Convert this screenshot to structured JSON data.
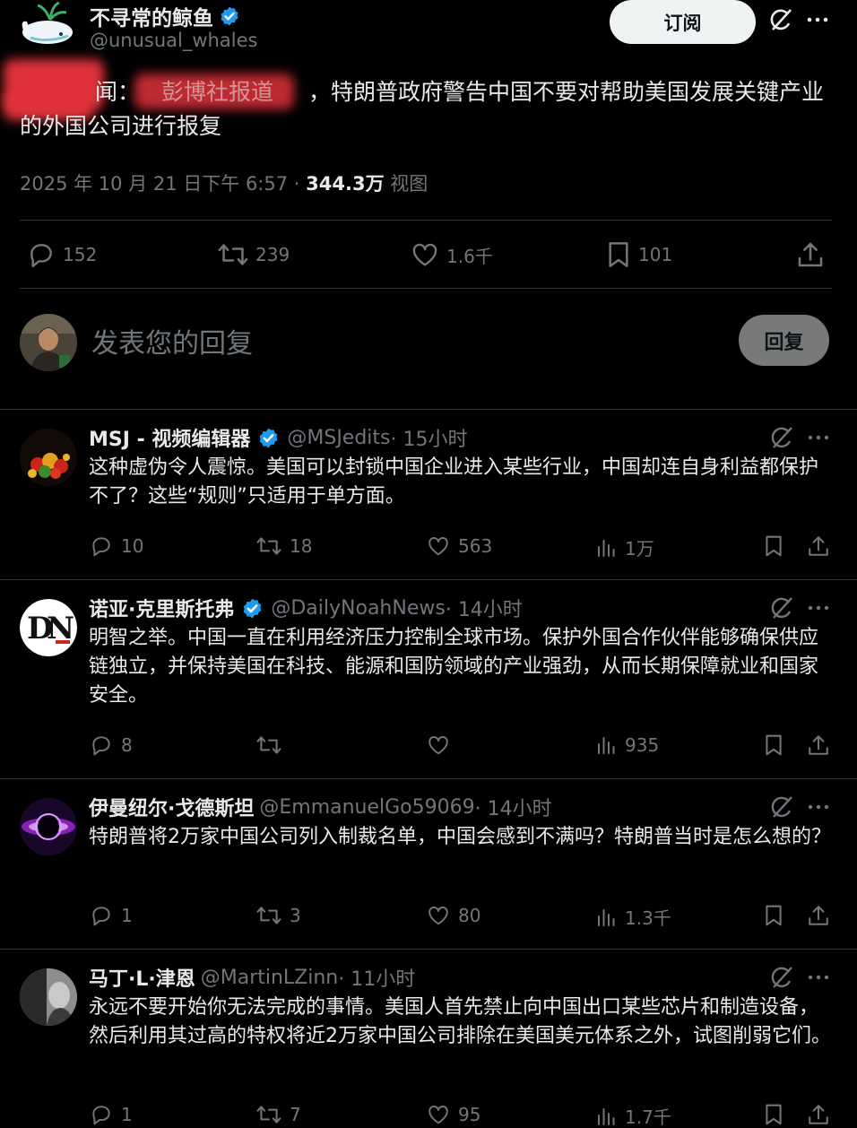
{
  "main_post": {
    "author_name": "不寻常的鲸鱼",
    "author_handle": "@unusual_whales",
    "subscribe_label": "订阅",
    "text_visible_prefix": "闻：",
    "text_visible_fragment": "彭博社报道",
    "text": "，特朗普政府警告中国不要对帮助美国发展关键产业的外国公司进行报复",
    "timestamp": "2025 年 10 月 21 日下午 6:57",
    "separator": " · ",
    "views_count": "344.3万",
    "views_label": " 视图",
    "stats": {
      "replies": "152",
      "reposts": "239",
      "likes": "1.6千",
      "bookmarks": "101"
    },
    "colors": {
      "verified": "#1d9bf0",
      "redaction": "#e0323a"
    }
  },
  "composer": {
    "placeholder": "发表您的回复",
    "reply_button": "回复"
  },
  "replies": [
    {
      "name": "MSJ - 视频编辑器",
      "verified": true,
      "handle": "@MSJedits",
      "time": " · 15小时",
      "text": "这种虚伪令人震惊。美国可以封锁中国企业进入某些行业，中国却连自身利益都保护不了？这些“规则”只适用于单方面。",
      "replies": "10",
      "reposts": "18",
      "likes": "563",
      "views": "1万"
    },
    {
      "name": "诺亚·克里斯托弗",
      "verified": true,
      "handle": "@DailyNoahNews",
      "time": " · 14小时",
      "text": "明智之举。中国一直在利用经济压力控制全球市场。保护外国合作伙伴能够确保供应链独立，并保持美国在科技、能源和国防领域的产业强劲，从而长期保障就业和国家安全。",
      "replies": "8",
      "reposts": "",
      "likes": "",
      "views": "935"
    },
    {
      "name": "伊曼纽尔·戈德斯坦",
      "verified": false,
      "handle": "@EmmanuelGo59069",
      "time": " · 14小时",
      "text": "特朗普将2万家中国公司列入制裁名单，中国会感到不满吗？特朗普当时是怎么想的？",
      "replies": "1",
      "reposts": "3",
      "likes": "80",
      "views": "1.3千"
    },
    {
      "name": "马丁·L·津恩",
      "verified": false,
      "handle": "@MartinLZinn",
      "time": " · 11小时",
      "text": "永远不要开始你无法完成的事情。美国人首先禁止向中国出口某些芯片和制造设备，然后利用其过高的特权将近2万家中国公司排除在美国美元体系之外，试图削弱它们。",
      "replies": "1",
      "reposts": "7",
      "likes": "95",
      "views": "1.7千"
    }
  ],
  "icons": {
    "reply": "speech-bubble-icon",
    "repost": "repost-arrows-icon",
    "like": "heart-icon",
    "bookmark": "bookmark-icon",
    "share": "share-upload-icon",
    "views": "bar-chart-icon",
    "grok": "grok-slash-icon",
    "more": "more-dots-icon"
  }
}
